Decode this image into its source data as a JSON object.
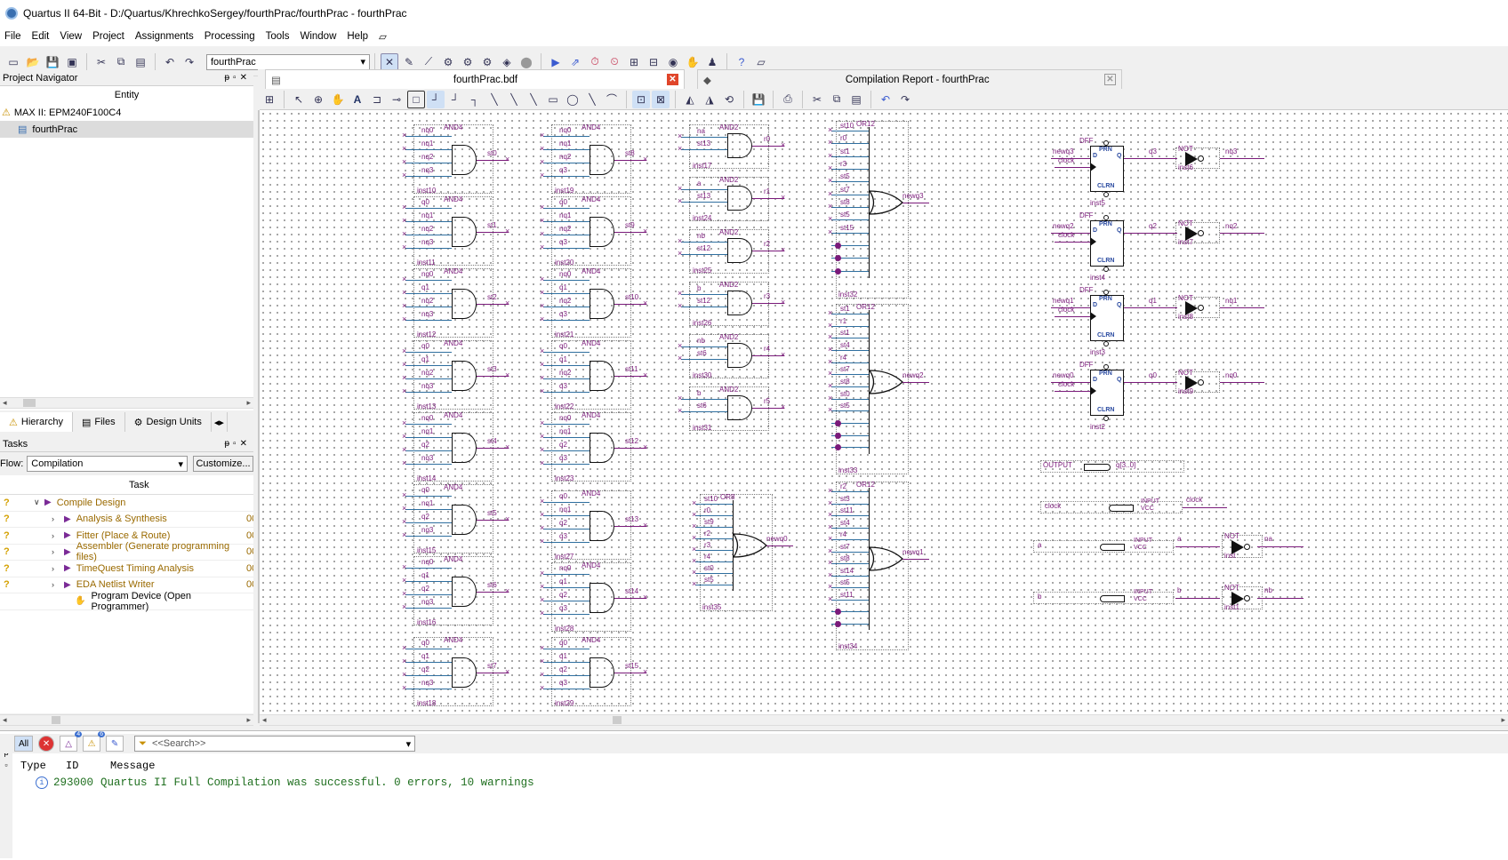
{
  "window": {
    "title": "Quartus II 64-Bit - D:/Quartus/KhrechkoSergey/fourthPrac/fourthPrac - fourthPrac"
  },
  "menu": [
    "File",
    "Edit",
    "View",
    "Project",
    "Assignments",
    "Processing",
    "Tools",
    "Window",
    "Help"
  ],
  "toolbar": {
    "project_combo": "fourthPrac"
  },
  "navigator": {
    "title": "Project Navigator",
    "column": "Entity",
    "device": "MAX II: EPM240F100C4",
    "top_entity": "fourthPrac",
    "tabs": [
      "Hierarchy",
      "Files",
      "Design Units"
    ]
  },
  "tasks": {
    "title": "Tasks",
    "flow_label": "Flow:",
    "flow_value": "Compilation",
    "customize": "Customize...",
    "column": "Task",
    "rows": [
      {
        "label": "Compile Design",
        "status": "?",
        "time": ""
      },
      {
        "label": "Analysis & Synthesis",
        "status": "?",
        "time": "00"
      },
      {
        "label": "Fitter (Place & Route)",
        "status": "?",
        "time": "00"
      },
      {
        "label": "Assembler (Generate programming files)",
        "status": "?",
        "time": "00"
      },
      {
        "label": "TimeQuest Timing Analysis",
        "status": "?",
        "time": "00"
      },
      {
        "label": "EDA Netlist Writer",
        "status": "?",
        "time": "00"
      },
      {
        "label": "Program Device (Open Programmer)",
        "status": "",
        "time": ""
      }
    ]
  },
  "doc_tabs": {
    "bdf": "fourthPrac.bdf",
    "report": "Compilation Report - fourthPrac"
  },
  "schematic": {
    "and_col1": [
      {
        "inst": "inst10",
        "ins": [
          "nq0",
          "nq1",
          "nq2",
          "nq3"
        ],
        "out": "st0"
      },
      {
        "inst": "inst11",
        "ins": [
          "q0",
          "nq1",
          "nq2",
          "nq3"
        ],
        "out": "st1"
      },
      {
        "inst": "inst12",
        "ins": [
          "nq0",
          "q1",
          "nq2",
          "nq3"
        ],
        "out": "st2"
      },
      {
        "inst": "inst13",
        "ins": [
          "q0",
          "q1",
          "nq2",
          "nq3"
        ],
        "out": "st3"
      },
      {
        "inst": "inst14",
        "ins": [
          "nq0",
          "nq1",
          "q2",
          "nq3"
        ],
        "out": "st4"
      },
      {
        "inst": "inst15",
        "ins": [
          "q0",
          "nq1",
          "q2",
          "nq3"
        ],
        "out": "st5"
      },
      {
        "inst": "inst16",
        "ins": [
          "nq0",
          "q1",
          "q2",
          "nq3"
        ],
        "out": "st6"
      },
      {
        "inst": "inst18",
        "ins": [
          "q0",
          "q1",
          "q2",
          "nq3"
        ],
        "out": "st7"
      }
    ],
    "and_col2": [
      {
        "inst": "inst19",
        "ins": [
          "nq0",
          "nq1",
          "nq2",
          "q3"
        ],
        "out": "st8"
      },
      {
        "inst": "inst20",
        "ins": [
          "q0",
          "nq1",
          "nq2",
          "q3"
        ],
        "out": "st9"
      },
      {
        "inst": "inst21",
        "ins": [
          "nq0",
          "q1",
          "nq2",
          "q3"
        ],
        "out": "st10"
      },
      {
        "inst": "inst22",
        "ins": [
          "q0",
          "q1",
          "nq2",
          "q3"
        ],
        "out": "st11"
      },
      {
        "inst": "inst23",
        "ins": [
          "nq0",
          "nq1",
          "q2",
          "q3"
        ],
        "out": "st12"
      },
      {
        "inst": "inst27",
        "ins": [
          "q0",
          "nq1",
          "q2",
          "q3"
        ],
        "out": "st13"
      },
      {
        "inst": "inst28",
        "ins": [
          "nq0",
          "q1",
          "q2",
          "q3"
        ],
        "out": "st14"
      },
      {
        "inst": "inst29",
        "ins": [
          "q0",
          "q1",
          "q2",
          "q3"
        ],
        "out": "st15"
      }
    ],
    "and2": [
      {
        "inst": "inst17",
        "ins": [
          "na",
          "st13"
        ],
        "out": "r0"
      },
      {
        "inst": "inst24",
        "ins": [
          "a",
          "st13"
        ],
        "out": "r1"
      },
      {
        "inst": "inst25",
        "ins": [
          "nb",
          "st12"
        ],
        "out": "r2"
      },
      {
        "inst": "inst26",
        "ins": [
          "b",
          "st12"
        ],
        "out": "r3"
      },
      {
        "inst": "inst30",
        "ins": [
          "nb",
          "st6"
        ],
        "out": "r4"
      },
      {
        "inst": "inst31",
        "ins": [
          "b",
          "st6"
        ],
        "out": "r5"
      }
    ],
    "or_gates": [
      {
        "inst": "inst32",
        "type": "OR12",
        "ins": [
          "st10",
          "r0",
          "st1",
          "r3",
          "st5",
          "st7",
          "st8",
          "st5",
          "st15",
          "",
          "",
          ""
        ],
        "out": "newq3"
      },
      {
        "inst": "inst33",
        "type": "OR12",
        "ins": [
          "st1",
          "r1",
          "st1",
          "st4",
          "r4",
          "st7",
          "st8",
          "st0",
          "st5",
          "",
          "",
          ""
        ],
        "out": "newq2"
      },
      {
        "inst": "inst34",
        "type": "OR12",
        "ins": [
          "r2",
          "st3",
          "st11",
          "st4",
          "r4",
          "st7",
          "st8",
          "st14",
          "st5",
          "st11",
          "",
          ""
        ],
        "out": "newq1"
      },
      {
        "inst": "inst35",
        "type": "OR8",
        "ins": [
          "st10",
          "r0",
          "st9",
          "r2",
          "r3",
          "r4",
          "st0",
          "st5"
        ],
        "out": "newq0"
      }
    ],
    "dffs": [
      {
        "inst": "inst5",
        "d": "newq3",
        "clk": "clock",
        "q": "q3",
        "not_inst": "inst6",
        "nq": "nq3"
      },
      {
        "inst": "inst4",
        "d": "newq2",
        "clk": "clock",
        "q": "q2",
        "not_inst": "inst7",
        "nq": "nq2"
      },
      {
        "inst": "inst3",
        "d": "newq1",
        "clk": "clock",
        "q": "q1",
        "not_inst": "inst8",
        "nq": "nq1"
      },
      {
        "inst": "inst2",
        "d": "newq0",
        "clk": "clock",
        "q": "q0",
        "not_inst": "inst9",
        "nq": "nq0"
      }
    ],
    "pins": {
      "output": {
        "kind": "OUTPUT",
        "name": "q[3..0]"
      },
      "inputs": [
        {
          "name": "clock",
          "net": "clock"
        },
        {
          "name": "a",
          "net": "a",
          "not": "inst",
          "nnet": "na"
        },
        {
          "name": "b",
          "net": "b",
          "not": "inst1",
          "nnet": "nb"
        }
      ],
      "input_kind": "INPUT",
      "vcc": "VCC",
      "dff_kind": "DFF",
      "and4": "AND4",
      "and2": "AND2",
      "not": "NOT",
      "prn": "PRN",
      "clrn": "CLRN",
      "d": "D",
      "q": "Q"
    }
  },
  "messages": {
    "all": "All",
    "search_placeholder": "<<Search>>",
    "warn_count": "4",
    "info_count": "6",
    "headers": [
      "Type",
      "ID",
      "Message"
    ],
    "row": {
      "id": "293000",
      "text": "Quartus II Full Compilation was successful. 0 errors, 10 warnings"
    }
  }
}
